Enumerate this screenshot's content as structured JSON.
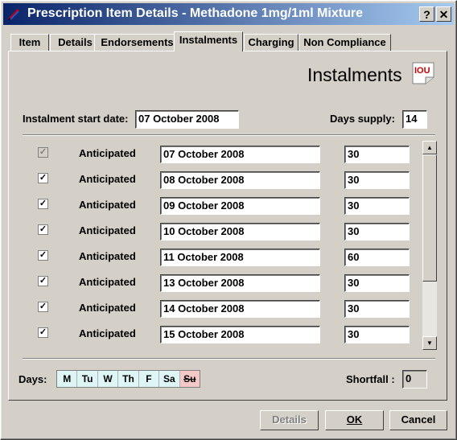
{
  "window": {
    "title": "Prescription Item Details - Methadone 1mg/1ml Mixture",
    "help_label": "?",
    "close_label": "✕"
  },
  "tabs": [
    "Item",
    "Details",
    "Endorsements",
    "Instalments",
    "Charging",
    "Non Compliance"
  ],
  "active_tab": "Instalments",
  "heading": "Instalments",
  "iou_badge": "IOU",
  "start_date": {
    "label": "Instalment start date:",
    "value": "07 October 2008"
  },
  "days_supply": {
    "label": "Days supply:",
    "value": "14"
  },
  "instalments": [
    {
      "checked": true,
      "disabled": true,
      "status": "Anticipated",
      "date": "07 October 2008",
      "qty": "30"
    },
    {
      "checked": true,
      "disabled": false,
      "status": "Anticipated",
      "date": "08 October 2008",
      "qty": "30"
    },
    {
      "checked": true,
      "disabled": false,
      "status": "Anticipated",
      "date": "09 October 2008",
      "qty": "30"
    },
    {
      "checked": true,
      "disabled": false,
      "status": "Anticipated",
      "date": "10 October 2008",
      "qty": "30"
    },
    {
      "checked": true,
      "disabled": false,
      "status": "Anticipated",
      "date": "11 October 2008",
      "qty": "60"
    },
    {
      "checked": true,
      "disabled": false,
      "status": "Anticipated",
      "date": "13 October 2008",
      "qty": "30"
    },
    {
      "checked": true,
      "disabled": false,
      "status": "Anticipated",
      "date": "14 October 2008",
      "qty": "30"
    },
    {
      "checked": true,
      "disabled": false,
      "status": "Anticipated",
      "date": "15 October 2008",
      "qty": "30"
    }
  ],
  "days": {
    "label": "Days:",
    "items": [
      "M",
      "Tu",
      "W",
      "Th",
      "F",
      "Sa",
      "Su"
    ]
  },
  "shortfall": {
    "label": "Shortfall :",
    "value": "0"
  },
  "buttons": {
    "details": "Details",
    "ok": "OK",
    "cancel": "Cancel"
  },
  "colors": {
    "title_start": "#0a246a",
    "title_end": "#a6caf0",
    "face": "#d4d0c8",
    "weekday_bg": "#ddf5f5",
    "sunday_bg": "#f5c8c8"
  }
}
